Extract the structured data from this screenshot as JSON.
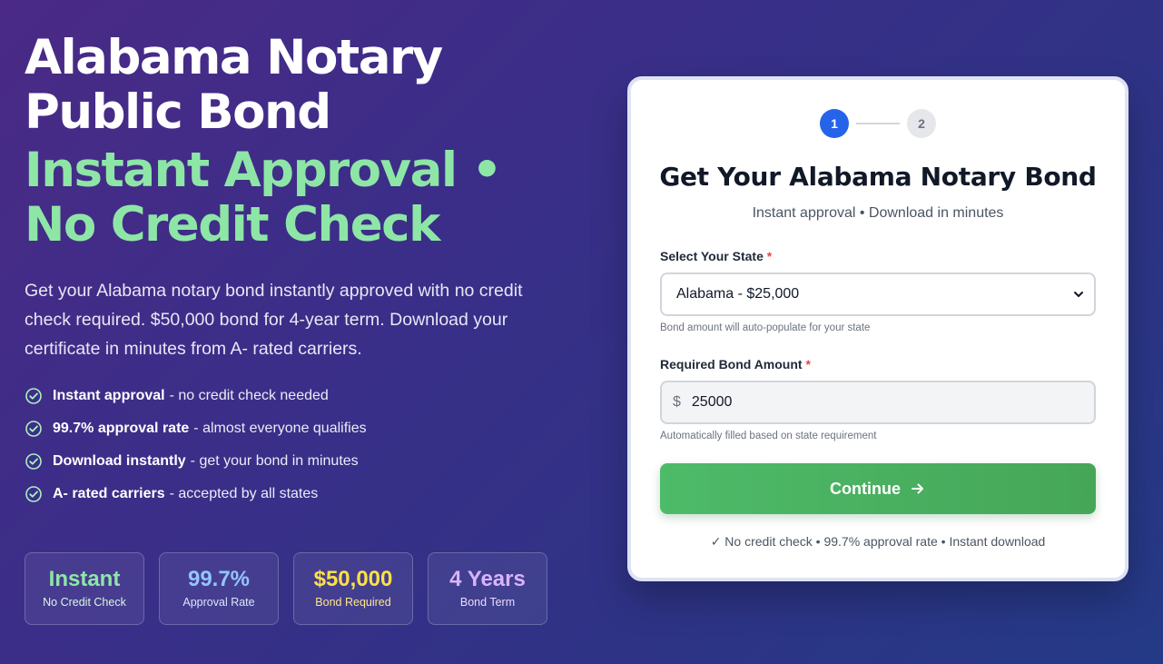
{
  "hero": {
    "title_line1": "Alabama Notary",
    "title_line2": "Public Bond",
    "accent_line1": "Instant Approval •",
    "accent_line2": "No Credit Check",
    "lead": "Get your Alabama notary bond instantly approved with no credit check required. $50,000 bond for 4-year term. Download your certificate in minutes from A- rated carriers.",
    "features": [
      {
        "bold": "Instant approval",
        "text": "- no credit check needed"
      },
      {
        "bold": "99.7% approval rate",
        "text": "- almost everyone qualifies"
      },
      {
        "bold": "Download instantly",
        "text": "- get your bond in minutes"
      },
      {
        "bold": "A- rated carriers",
        "text": "- accepted by all states"
      }
    ]
  },
  "stats": [
    {
      "value": "Instant",
      "label": "No Credit Check",
      "value_color": "#8ee6a6",
      "label_color": "#d9f7e2"
    },
    {
      "value": "99.7%",
      "label": "Approval Rate",
      "value_color": "#93c5fd",
      "label_color": "#dbe6fb"
    },
    {
      "value": "$50,000",
      "label": "Bond Required",
      "value_color": "#fde047",
      "label_color": "#fde68a"
    },
    {
      "value": "4 Years",
      "label": "Bond Term",
      "value_color": "#d8b4fe",
      "label_color": "#e9dcfb"
    }
  ],
  "card": {
    "steps": [
      "1",
      "2"
    ],
    "title": "Get Your Alabama Notary Bond",
    "subtitle": "Instant approval • Download in minutes",
    "state_label": "Select Your State",
    "required_mark": "*",
    "state_value": "Alabama - $25,000",
    "state_hint": "Bond amount will auto-populate for your state",
    "amount_label": "Required Bond Amount",
    "amount_prefix": "$",
    "amount_value": "25000",
    "amount_hint": "Automatically filled based on state requirement",
    "continue_label": "Continue",
    "trust_line": "✓ No credit check • 99.7% approval rate • Instant download"
  },
  "colors": {
    "accent_green": "#8ee6a6",
    "step_active": "#2563eb",
    "continue_green": "#4dbb69",
    "required_red": "#ef4444"
  }
}
